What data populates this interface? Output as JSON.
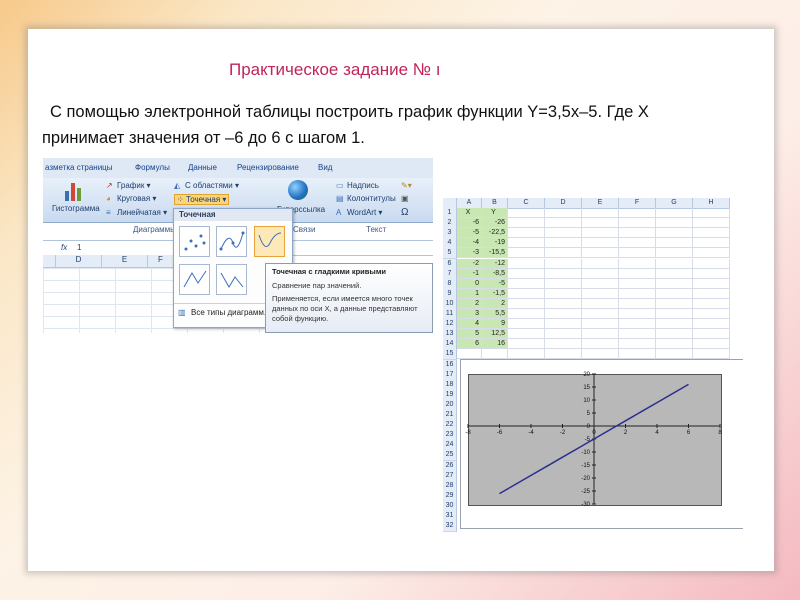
{
  "slide": {
    "title": "Практическое задание № ı",
    "task_line1": "С помощью электронной таблицы построить график функции Y=3,5x–5. Где X",
    "task_line2": "принимает значения от –6 до 6 с шагом 1."
  },
  "ribbon": {
    "tabs": [
      "азметка страницы",
      "Формулы",
      "Данные",
      "Рецензирование",
      "Вид"
    ],
    "buttons": {
      "histogram": "Гистограмма",
      "graph": "График ▾",
      "pie": "Круговая ▾",
      "bar": "Линейчатая ▾",
      "area": "С областями ▾",
      "scatter": "Точечная ▾",
      "hyperlink": "Гиперссылка",
      "textbox": "Надпись",
      "header_footer": "Колонтитулы",
      "wordart": "WordArt ▾",
      "omega": "Ω"
    },
    "group_names": {
      "charts": "Диаграммы",
      "links": "Связи",
      "text": "Текст"
    },
    "formula_value": "1",
    "fx": "fx",
    "columns": [
      "D",
      "E",
      "F"
    ],
    "dropdown_title": "Точечная",
    "all_chart_types": "Все типы диаграмм...",
    "tooltip_title": "Точечная с гладкими кривыми",
    "tooltip_line1": "Сравнение пар значений.",
    "tooltip_line2": "Применяется, если имеется много точек данных по оси X, а данные представляют собой функцию."
  },
  "sheet": {
    "columns": [
      "A",
      "B",
      "C",
      "D",
      "E",
      "F",
      "G",
      "H"
    ],
    "header_row": [
      "X",
      "Y"
    ],
    "rows": [
      [
        "-6",
        "-26"
      ],
      [
        "-5",
        "-22,5"
      ],
      [
        "-4",
        "-19"
      ],
      [
        "-3",
        "-15,5"
      ],
      [
        "-2",
        "-12"
      ],
      [
        "-1",
        "-8,5"
      ],
      [
        "0",
        "-5"
      ],
      [
        "1",
        "-1,5"
      ],
      [
        "2",
        "2"
      ],
      [
        "3",
        "5,5"
      ],
      [
        "4",
        "9"
      ],
      [
        "5",
        "12,5"
      ],
      [
        "6",
        "16"
      ]
    ],
    "row_count": 32
  },
  "chart_data": {
    "type": "line",
    "x": [
      -6,
      -5,
      -4,
      -3,
      -2,
      -1,
      0,
      1,
      2,
      3,
      4,
      5,
      6
    ],
    "series": [
      {
        "values": [
          -26,
          -22.5,
          -19,
          -15.5,
          -12,
          -8.5,
          -5,
          -1.5,
          2,
          5.5,
          9,
          12.5,
          16
        ]
      }
    ],
    "xlim": [
      -8,
      8
    ],
    "ylim": [
      -30,
      20
    ],
    "x_ticks": [
      "-8",
      "-6",
      "-4",
      "-2",
      "0",
      "2",
      "4",
      "6",
      "8"
    ],
    "y_ticks": [
      "20",
      "15",
      "10",
      "5",
      "0",
      "-5",
      "-10",
      "-15",
      "-20",
      "-25",
      "-30"
    ],
    "line_color": "#2b2f8f",
    "plot_background": "#b8b8b8"
  }
}
